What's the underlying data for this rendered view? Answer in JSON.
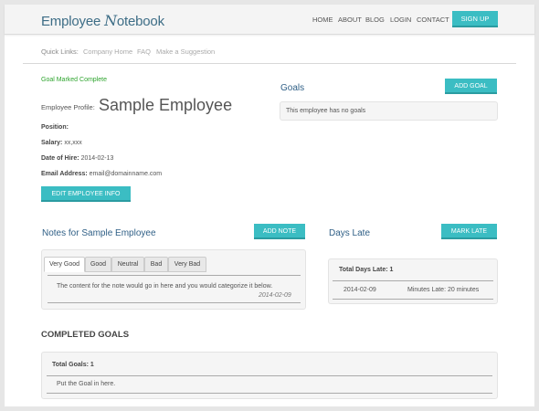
{
  "header": {
    "logo_prefix": "Employee ",
    "logo_n": "N",
    "logo_suffix": "otebook",
    "nav": [
      "HOME",
      "ABOUT",
      "BLOG",
      "LOGIN",
      "CONTACT"
    ],
    "signup": "SIGN UP"
  },
  "quick_links": {
    "label": "Quick Links:",
    "links": [
      "Company Home",
      "FAQ",
      "Make a Suggestion"
    ]
  },
  "status_message": "Goal Marked Complete",
  "profile": {
    "label": "Employee Profile:",
    "name": "Sample Employee",
    "position_label": "Position:",
    "position_value": "",
    "salary_label": "Salary:",
    "salary_value": "xx,xxx",
    "hire_label": "Date of Hire:",
    "hire_value": "2014-02-13",
    "email_label": "Email Address:",
    "email_value": "email@domainname.com",
    "edit_button": "EDIT EMPLOYEE INFO"
  },
  "goals": {
    "title": "Goals",
    "add_button": "ADD GOAL",
    "empty_text": "This employee has no goals"
  },
  "notes": {
    "title": "Notes for Sample Employee",
    "add_button": "ADD NOTE",
    "tabs": [
      "Very Good",
      "Good",
      "Neutral",
      "Bad",
      "Very Bad"
    ],
    "active_tab": "Very Good",
    "content": "The content for the note would go in here and you would categorize it below.",
    "date": "2014-02-09"
  },
  "days_late": {
    "title": "Days Late",
    "mark_button": "MARK LATE",
    "total_label": "Total Days Late: 1",
    "entries": [
      {
        "date": "2014-02-09",
        "minutes": "Minutes Late: 20 minutes"
      }
    ]
  },
  "completed_goals": {
    "title": "COMPLETED GOALS",
    "total_label": "Total Goals: 1",
    "items": [
      "Put the Goal in here."
    ]
  },
  "colors": {
    "accent": "#3bbdc3",
    "heading": "#2f5f86",
    "success": "#2ea42e"
  }
}
